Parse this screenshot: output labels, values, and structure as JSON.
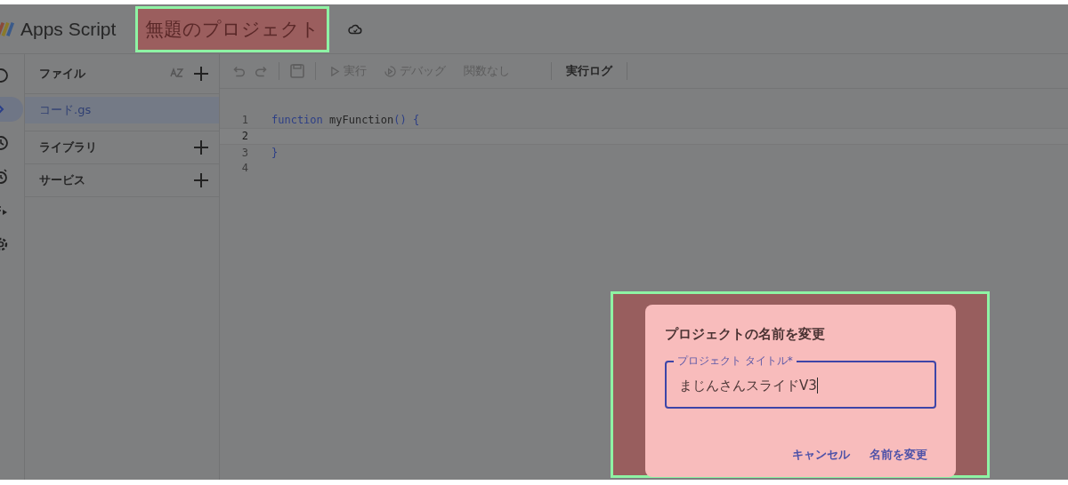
{
  "header": {
    "product": "Apps Script",
    "project_title": {
      "text": "無題のプロジェクト",
      "highlighted": true
    }
  },
  "rail": [
    {
      "kind": "info",
      "selected": false
    },
    {
      "kind": "code",
      "selected": true
    },
    {
      "kind": "history",
      "selected": false
    },
    {
      "kind": "trigger",
      "selected": false
    },
    {
      "kind": "executions",
      "selected": false
    },
    {
      "kind": "settings",
      "selected": false
    }
  ],
  "files_panel": {
    "title": "ファイル",
    "files": [
      {
        "name": "コード.gs",
        "selected": true
      }
    ],
    "sections": [
      {
        "label": "ライブラリ"
      },
      {
        "label": "サービス"
      }
    ]
  },
  "toolbar": {
    "run": "実行",
    "debug": "デバッグ",
    "function": "関数なし",
    "log": "実行ログ"
  },
  "editor": {
    "lines": [
      {
        "number": "1",
        "current": false,
        "tokens": [
          {
            "text": "function",
            "kind": "keyword"
          },
          {
            "text": " myFunction",
            "kind": "name"
          },
          {
            "text": "() {",
            "kind": "punct"
          }
        ]
      },
      {
        "number": "2",
        "current": true
      },
      {
        "number": "3",
        "current": false,
        "tokens": [
          {
            "text": "}",
            "kind": "punct"
          }
        ]
      },
      {
        "number": "4",
        "current": false
      }
    ]
  },
  "dialog": {
    "highlighted": true,
    "title": "プロジェクトの名前を変更",
    "field": {
      "label": "プロジェクト タイトル*",
      "value": "まじんさんスライドV3"
    },
    "buttons": [
      "キャンセル",
      "名前を変更"
    ]
  }
}
